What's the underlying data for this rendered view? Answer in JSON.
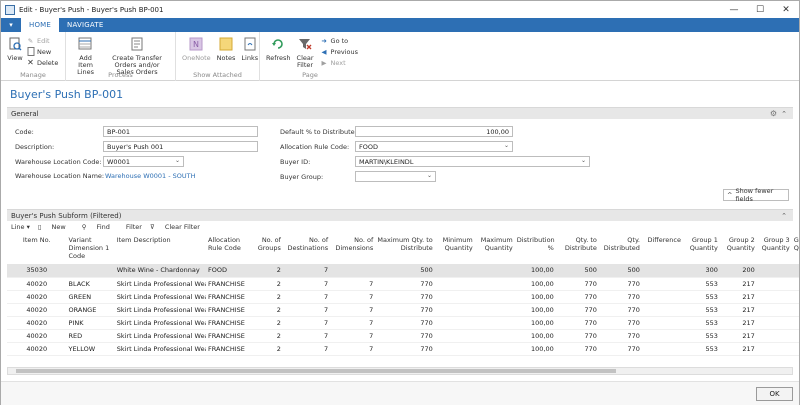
{
  "window": {
    "title": "Edit - Buyer's Push - Buyer's Push BP-001",
    "minimize": "—",
    "maximize": "☐",
    "close": "✕"
  },
  "tabs": {
    "dropdown": "▾",
    "home": "HOME",
    "navigate": "NAVIGATE"
  },
  "ribbon": {
    "manage": {
      "name": "Manage",
      "view": "View",
      "edit": "Edit",
      "new": "New",
      "delete": "Delete"
    },
    "process": {
      "name": "Process",
      "add_item_lines": "Add Item Lines",
      "create_transfer": "Create Transfer Orders and/or Sales Orders"
    },
    "show_attached": {
      "name": "Show Attached",
      "onenote": "OneNote",
      "notes": "Notes",
      "links": "Links"
    },
    "page": {
      "name": "Page",
      "refresh": "Refresh",
      "clear_filter": "Clear Filter",
      "go_to": "Go to",
      "previous": "Previous",
      "next": "Next"
    }
  },
  "page_title": "Buyer's Push BP-001",
  "general": {
    "header": "General",
    "code_label": "Code:",
    "code": "BP-001",
    "description_label": "Description:",
    "description": "Buyer's Push 001",
    "warehouse_code_label": "Warehouse Location Code:",
    "warehouse_code": "W0001",
    "warehouse_name_label": "Warehouse Location Name:",
    "warehouse_name": "Warehouse W0001 - SOUTH",
    "pct_label": "Default % to Distribute:",
    "pct": "100,00",
    "alloc_label": "Allocation Rule Code:",
    "alloc": "FOOD",
    "buyer_id_label": "Buyer ID:",
    "buyer_id": "MARTIN\\KLEINDL",
    "buyer_group_label": "Buyer Group:",
    "buyer_group": "",
    "show_fewer": "Show fewer fields"
  },
  "subform": {
    "header": "Buyer's Push Subform (Filtered)",
    "toolbar": {
      "line": "Line ▾",
      "new": "New",
      "find": "Find",
      "filter": "Filter",
      "clear_filter": "Clear Filter"
    },
    "columns": [
      "Item No.",
      "Variant Dimension 1 Code",
      "Item Description",
      "Allocation Rule Code",
      "No. of Groups",
      "No. of Destinations",
      "No. of Dimensions",
      "Maximum Qty. to Distribute",
      "Minimum Quantity",
      "Maximum Quantity",
      "Distribution %",
      "Qty. to Distribute",
      "Qty. Distributed",
      "Difference",
      "Group 1 Quantity",
      "Group 2 Quantity",
      "Group 3 Quantity",
      "G Q"
    ],
    "rows": [
      [
        "35030",
        "",
        "White Wine - Chardonnay",
        "FOOD",
        "2",
        "7",
        "",
        "500",
        "",
        "",
        "100,00",
        "500",
        "500",
        "",
        "300",
        "200",
        "",
        ""
      ],
      [
        "40020",
        "BLACK",
        "Skirt Linda Professional Wear",
        "FRANCHISE",
        "2",
        "7",
        "7",
        "770",
        "",
        "",
        "100,00",
        "770",
        "770",
        "",
        "553",
        "217",
        "",
        ""
      ],
      [
        "40020",
        "GREEN",
        "Skirt Linda Professional Wear",
        "FRANCHISE",
        "2",
        "7",
        "7",
        "770",
        "",
        "",
        "100,00",
        "770",
        "770",
        "",
        "553",
        "217",
        "",
        ""
      ],
      [
        "40020",
        "ORANGE",
        "Skirt Linda Professional Wear",
        "FRANCHISE",
        "2",
        "7",
        "7",
        "770",
        "",
        "",
        "100,00",
        "770",
        "770",
        "",
        "553",
        "217",
        "",
        ""
      ],
      [
        "40020",
        "PINK",
        "Skirt Linda Professional Wear",
        "FRANCHISE",
        "2",
        "7",
        "7",
        "770",
        "",
        "",
        "100,00",
        "770",
        "770",
        "",
        "553",
        "217",
        "",
        ""
      ],
      [
        "40020",
        "RED",
        "Skirt Linda Professional Wear",
        "FRANCHISE",
        "2",
        "7",
        "7",
        "770",
        "",
        "",
        "100,00",
        "770",
        "770",
        "",
        "553",
        "217",
        "",
        ""
      ],
      [
        "40020",
        "YELLOW",
        "Skirt Linda Professional Wear",
        "FRANCHISE",
        "2",
        "7",
        "7",
        "770",
        "",
        "",
        "100,00",
        "770",
        "770",
        "",
        "553",
        "217",
        "",
        ""
      ]
    ]
  },
  "ok_label": "OK"
}
